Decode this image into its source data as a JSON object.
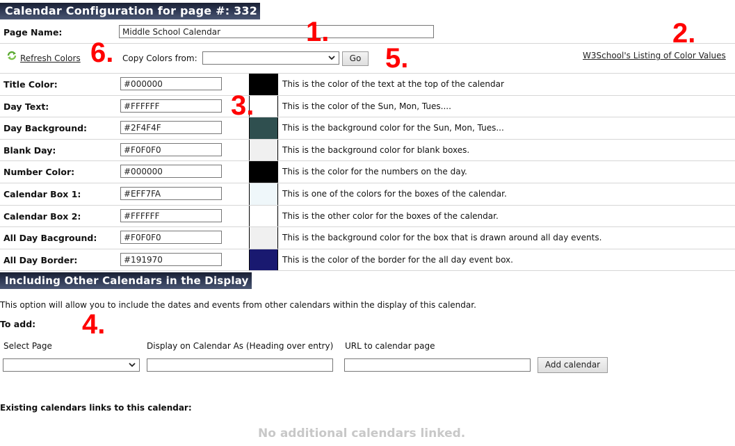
{
  "header": {
    "title": "Calendar Configuration for page #: 332"
  },
  "page_name": {
    "label": "Page Name:",
    "value": "Middle School Calendar"
  },
  "toolbar": {
    "refresh_label": "Refresh Colors",
    "refresh_icon": "refresh-icon",
    "copy_label": "Copy Colors from:",
    "copy_selected": "",
    "go_label": "Go",
    "w3_link": "W3School's Listing of Color Values"
  },
  "colors": [
    {
      "label": "Title Color:",
      "value": "#000000",
      "swatch": "#000000",
      "desc": "This is the color of the text at the top of the calendar"
    },
    {
      "label": "Day Text:",
      "value": "#FFFFFF",
      "swatch": "#FFFFFF",
      "desc": "This is the color of the Sun, Mon, Tues...."
    },
    {
      "label": "Day Background:",
      "value": "#2F4F4F",
      "swatch": "#2F4F4F",
      "desc": "This is the background color for the Sun, Mon, Tues..."
    },
    {
      "label": "Blank Day:",
      "value": "#F0F0F0",
      "swatch": "#F0F0F0",
      "desc": "This is the background color for blank boxes."
    },
    {
      "label": "Number Color:",
      "value": "#000000",
      "swatch": "#000000",
      "desc": "This is the color for the numbers on the day."
    },
    {
      "label": "Calendar Box 1:",
      "value": "#EFF7FA",
      "swatch": "#EFF7FA",
      "desc": "This is one of the colors for the boxes of the calendar."
    },
    {
      "label": "Calendar Box 2:",
      "value": "#FFFFFF",
      "swatch": "#FFFFFF",
      "desc": "This is the other color for the boxes of the calendar."
    },
    {
      "label": "All Day Bacground:",
      "value": "#F0F0F0",
      "swatch": "#F0F0F0",
      "desc": "This is the background color for the box that is drawn around all day events."
    },
    {
      "label": "All Day Border:",
      "value": "#191970",
      "swatch": "#191970",
      "desc": "This is the color of the border for the all day event box."
    }
  ],
  "include": {
    "title": "Including Other Calendars in the Display",
    "intro": "This option will allow you to include the dates and events from other calendars within the display of this calendar.",
    "to_add": "To add:",
    "col_select": "Select Page",
    "col_display": "Display on Calendar As (Heading over entry)",
    "col_url": "URL to calendar page",
    "select_value": "",
    "display_value": "",
    "url_value": "",
    "add_button": "Add calendar",
    "existing_label": "Existing calendars links to this calendar:",
    "empty_message": "No additional calendars linked."
  },
  "annotations": [
    "1.",
    "2.",
    "3.",
    "4.",
    "5.",
    "6."
  ],
  "theme": {
    "annotation_color": "#FF0000",
    "header_bg": "#2B3550"
  }
}
